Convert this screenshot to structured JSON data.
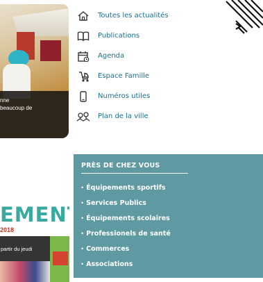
{
  "photo_card": {
    "caption_line1": "nne",
    "caption_line2": "beaucoup de"
  },
  "quick_links": [
    {
      "icon": "home-icon",
      "label": "Toutes les actualités"
    },
    {
      "icon": "book-icon",
      "label": "Publications"
    },
    {
      "icon": "calendar-icon",
      "label": "Agenda"
    },
    {
      "icon": "stroller-icon",
      "label": "Espace Famille"
    },
    {
      "icon": "phone-icon",
      "label": "Numéros utiles"
    },
    {
      "icon": "map-icon",
      "label": "Plan de la ville"
    }
  ],
  "promo": {
    "headline": "EMENT",
    "year": "2018",
    "info": "partir du jeudi"
  },
  "near_you": {
    "title": "PRÈS DE CHEZ VOUS",
    "items": [
      "Équipements sportifs",
      "Services Publics",
      "Équipements scolaires",
      "Professionels de santé",
      "Commerces",
      "Associations"
    ]
  },
  "colors": {
    "link": "#1d6f8c",
    "panel": "#5f9aa2",
    "promo_text": "#3aa9a0"
  }
}
